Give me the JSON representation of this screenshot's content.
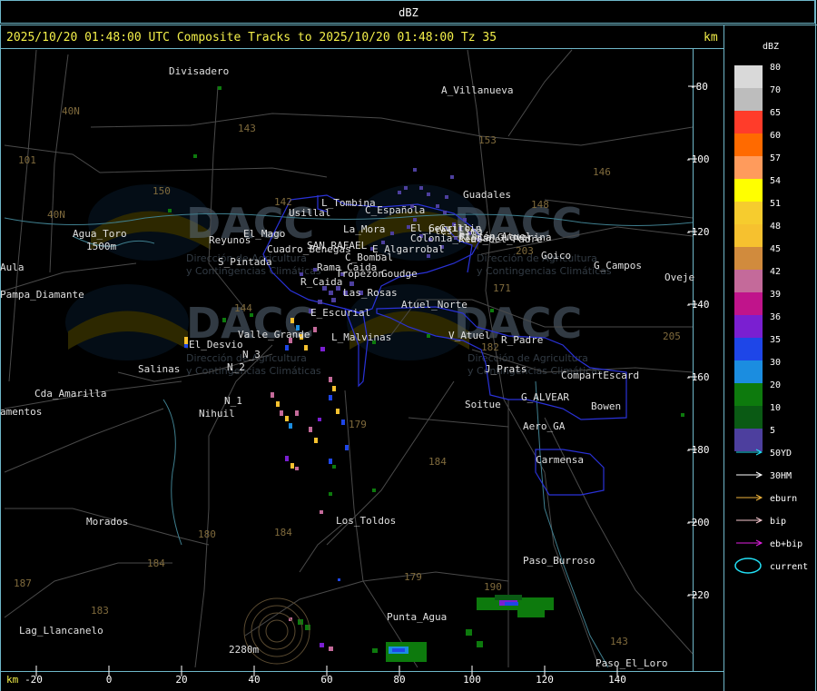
{
  "header": {
    "title": "dBZ"
  },
  "map": {
    "title_line": "2025/10/20 01:48:00 UTC Composite Tracks to 2025/10/20 01:48:00 Tz 35",
    "unit": "km",
    "axis_unit_bottom": "km",
    "x_ticks": [
      "-20",
      "0",
      "20",
      "40",
      "60",
      "80",
      "100",
      "120",
      "140"
    ],
    "y_ticks": [
      "-80",
      "-100",
      "-120",
      "-140",
      "-160",
      "-180",
      "-200",
      "-220"
    ],
    "watermark": "DACC",
    "watermark_sub1": "Dirección de Agricultura",
    "watermark_sub2": "y Contingencias Climáticas",
    "place_labels": [
      "Divisadero",
      "A_Villanueva",
      "Guadales",
      "Usillal",
      "L_Tombina",
      "C_Española",
      "Agua_Toro",
      "1500m",
      "Reyunos",
      "El_Mago",
      "Pampa_Diamante",
      "Aula",
      "La_Mora",
      "El_Cerrito",
      "Cuadro_Benegas",
      "SAN_RAFAEL",
      "C_Bombal",
      "E_Algarrobal",
      "Goico",
      "G_Campos",
      "Oveje",
      "S_Pintada",
      "R_Caida",
      "Tropezon",
      "Goudge",
      "Rama_Caida",
      "Las_Rosas",
      "E_Escurial",
      "Atuel_Norte",
      "Valle_Grande",
      "L_Malvinas",
      "V_Atuel",
      "R_Padre",
      "El_Desvio",
      "N_3",
      "N_2",
      "Salinas",
      "CompartEscard",
      "J_Prats",
      "G_ALVEAR",
      "Bowen",
      "Soitue",
      "Cda_Amarilla",
      "N_1",
      "Nihuil",
      "Aero_GA",
      "amentos",
      "Carmensa",
      "Morados",
      "Los_Toldos",
      "Paso_Burroso",
      "Punta_Agua",
      "Lag_Llancanelo",
      "2280m",
      "Paso_El_Loro",
      "Colonia_Elena",
      "Real_del_Padre",
      "Ptes_Lima",
      "Guillin",
      "La_Guevarina",
      "Rincón_Atuel"
    ],
    "route_labels": [
      "143",
      "153",
      "146",
      "148",
      "203",
      "171",
      "150",
      "101",
      "40N",
      "40N",
      "144",
      "142",
      "182",
      "179",
      "184",
      "180",
      "184",
      "183",
      "190",
      "179",
      "143",
      "205",
      "184",
      "187"
    ]
  },
  "legend": {
    "title": "dBZ",
    "scale": [
      {
        "label": "80",
        "color": "#d9d9d9"
      },
      {
        "label": "70",
        "color": "#bdbdbd"
      },
      {
        "label": "65",
        "color": "#ff3c2a"
      },
      {
        "label": "60",
        "color": "#ff6a00"
      },
      {
        "label": "57",
        "color": "#ff9b5c"
      },
      {
        "label": "54",
        "color": "#ffff00"
      },
      {
        "label": "51",
        "color": "#f6cc2e"
      },
      {
        "label": "48",
        "color": "#f6c12f"
      },
      {
        "label": "45",
        "color": "#d18b3d"
      },
      {
        "label": "42",
        "color": "#c46a9a"
      },
      {
        "label": "39",
        "color": "#c0148b"
      },
      {
        "label": "36",
        "color": "#7a1fd1"
      },
      {
        "label": "35",
        "color": "#1e46e8"
      },
      {
        "label": "30",
        "color": "#1b8de0"
      },
      {
        "label": "20",
        "color": "#0d7a0d"
      },
      {
        "label": "10",
        "color": "#0a5a14"
      },
      {
        "label": "5",
        "color": "#4d3f9e"
      }
    ],
    "tracks": [
      {
        "label": "50YD",
        "color": "#22e0f5"
      },
      {
        "label": "30HM",
        "color": "#ffffff"
      },
      {
        "label": "eburn",
        "color": "#f0b43c"
      },
      {
        "label": "bip",
        "color": "#f7c9d0"
      },
      {
        "label": "eb+bip",
        "color": "#e020e0"
      },
      {
        "label": "current",
        "color": "#22e0f5"
      }
    ]
  }
}
